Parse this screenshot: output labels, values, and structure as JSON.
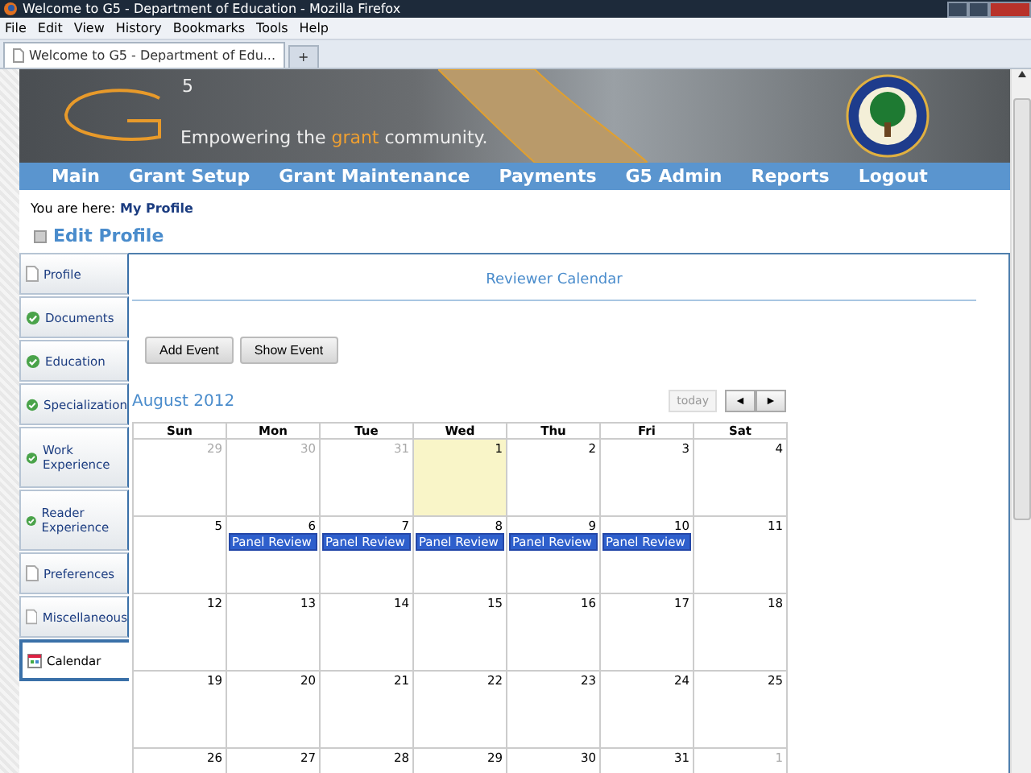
{
  "window": {
    "title": "Welcome to G5 - Department of Education - Mozilla Firefox"
  },
  "menu": [
    "File",
    "Edit",
    "View",
    "History",
    "Bookmarks",
    "Tools",
    "Help"
  ],
  "browser_tabs": [
    {
      "label": "Welcome to G5 - Department of Edu...",
      "selected": true
    },
    {
      "label": "+",
      "selected": false
    }
  ],
  "banner": {
    "logo_sub": "5",
    "tagline_before": "Empowering the ",
    "tagline_highlight": "grant",
    "tagline_after": " community."
  },
  "nav": [
    "Main",
    "Grant Setup",
    "Grant Maintenance",
    "Payments",
    "G5 Admin",
    "Reports",
    "Logout"
  ],
  "breadcrumb": {
    "label": "You are here:",
    "link": "My Profile"
  },
  "heading": "Edit Profile",
  "sidebar": [
    {
      "label": "Profile",
      "kind": "page",
      "selected": false
    },
    {
      "label": "Documents",
      "kind": "done",
      "selected": false
    },
    {
      "label": "Education",
      "kind": "done",
      "selected": false
    },
    {
      "label": "Specialization",
      "kind": "done",
      "selected": false
    },
    {
      "label": "Work Experience",
      "kind": "done",
      "selected": false
    },
    {
      "label": "Reader Experience",
      "kind": "done",
      "selected": false
    },
    {
      "label": "Preferences",
      "kind": "page",
      "selected": false
    },
    {
      "label": "Miscellaneous",
      "kind": "page",
      "selected": false
    },
    {
      "label": "Calendar",
      "kind": "calendar",
      "selected": true
    }
  ],
  "calendar": {
    "title": "Reviewer Calendar",
    "buttons": [
      "Add Event",
      "Show Event"
    ],
    "month": "August 2012",
    "today_button": "today",
    "prev": "◄",
    "next": "►",
    "weekdays": [
      "Sun",
      "Mon",
      "Tue",
      "Wed",
      "Thu",
      "Fri",
      "Sat"
    ],
    "weeks": [
      [
        {
          "day": "29",
          "other_month": true,
          "today": false
        },
        {
          "day": "30",
          "other_month": true,
          "today": false
        },
        {
          "day": "31",
          "other_month": true,
          "today": false
        },
        {
          "day": "1",
          "other_month": false,
          "today": true
        },
        {
          "day": "2",
          "other_month": false,
          "today": false
        },
        {
          "day": "3",
          "other_month": false,
          "today": false
        },
        {
          "day": "4",
          "other_month": false,
          "today": false
        }
      ],
      [
        {
          "day": "5",
          "other_month": false,
          "today": false
        },
        {
          "day": "6",
          "other_month": false,
          "today": false,
          "events": [
            "Panel Review"
          ]
        },
        {
          "day": "7",
          "other_month": false,
          "today": false,
          "events": [
            "Panel Review"
          ]
        },
        {
          "day": "8",
          "other_month": false,
          "today": false,
          "events": [
            "Panel Review"
          ]
        },
        {
          "day": "9",
          "other_month": false,
          "today": false,
          "events": [
            "Panel Review"
          ]
        },
        {
          "day": "10",
          "other_month": false,
          "today": false,
          "events": [
            "Panel Review"
          ]
        },
        {
          "day": "11",
          "other_month": false,
          "today": false
        }
      ],
      [
        {
          "day": "12",
          "other_month": false,
          "today": false
        },
        {
          "day": "13",
          "other_month": false,
          "today": false
        },
        {
          "day": "14",
          "other_month": false,
          "today": false
        },
        {
          "day": "15",
          "other_month": false,
          "today": false
        },
        {
          "day": "16",
          "other_month": false,
          "today": false
        },
        {
          "day": "17",
          "other_month": false,
          "today": false
        },
        {
          "day": "18",
          "other_month": false,
          "today": false
        }
      ],
      [
        {
          "day": "19",
          "other_month": false,
          "today": false
        },
        {
          "day": "20",
          "other_month": false,
          "today": false
        },
        {
          "day": "21",
          "other_month": false,
          "today": false
        },
        {
          "day": "22",
          "other_month": false,
          "today": false
        },
        {
          "day": "23",
          "other_month": false,
          "today": false
        },
        {
          "day": "24",
          "other_month": false,
          "today": false
        },
        {
          "day": "25",
          "other_month": false,
          "today": false
        }
      ],
      [
        {
          "day": "26",
          "other_month": false,
          "today": false
        },
        {
          "day": "27",
          "other_month": false,
          "today": false
        },
        {
          "day": "28",
          "other_month": false,
          "today": false
        },
        {
          "day": "29",
          "other_month": false,
          "today": false
        },
        {
          "day": "30",
          "other_month": false,
          "today": false
        },
        {
          "day": "31",
          "other_month": false,
          "today": false
        },
        {
          "day": "1",
          "other_month": true,
          "today": false
        }
      ]
    ]
  }
}
